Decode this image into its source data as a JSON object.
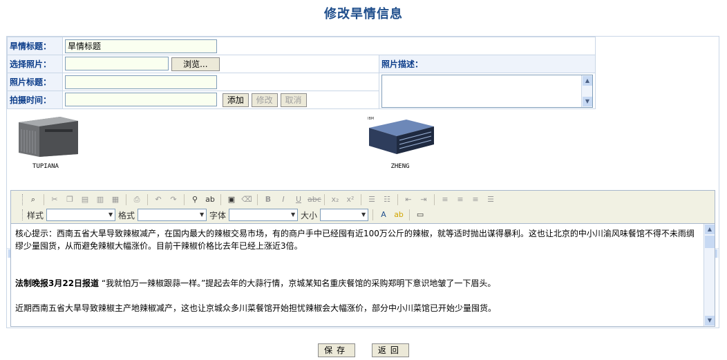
{
  "page": {
    "title": "修改旱情信息"
  },
  "form": {
    "title_label": "旱情标题：",
    "title_value": "旱情标题",
    "select_photo_label": "选择照片：",
    "select_photo_value": "",
    "browse_label": "浏览...",
    "photo_title_label": "照片标题：",
    "photo_title_value": "",
    "photo_desc_label": "照片描述：",
    "photo_desc_value": "",
    "shoot_time_label": "拍摄时间：",
    "shoot_time_value": "",
    "add_label": "添加",
    "modify_label": "修改",
    "cancel_label": "取消"
  },
  "photos": [
    {
      "label": "TUPIANA",
      "icon": "server-tower-image"
    },
    {
      "label": "ZHENG",
      "icon": "server-rack-image"
    }
  ],
  "editor": {
    "toolbar": {
      "style_label": "样式",
      "style_value": "",
      "format_label": "格式",
      "format_value": "",
      "font_label": "字体",
      "font_value": "",
      "size_label": "大小",
      "size_value": ""
    },
    "content": {
      "para1": "核心提示：西南五省大旱导致辣椒减产，在国内最大的辣椒交易市场，有的商户手中已经囤有近100万公斤的辣椒，就等适时抛出谋得暴利。这也让北京的中小川渝风味餐馆不得不未雨绸缪少量囤货，从而避免辣椒大幅涨价。目前干辣椒价格比去年已经上涨近3倍。",
      "para2_bold": "法制晚报3月22日报道",
      "para2_rest": " “我就怕万一辣椒跟蒜一样。”提起去年的大蒜行情，京城某知名重庆餐馆的采购郑明下意识地皱了一下眉头。",
      "para3": "近期西南五省大旱导致辣椒主产地辣椒减产，这也让京城众多川菜餐馆开始担忧辣椒会大幅涨价，部分中小川菜馆已开始少量囤货。"
    }
  },
  "actions": {
    "save_label": "保存",
    "back_label": "返回"
  }
}
